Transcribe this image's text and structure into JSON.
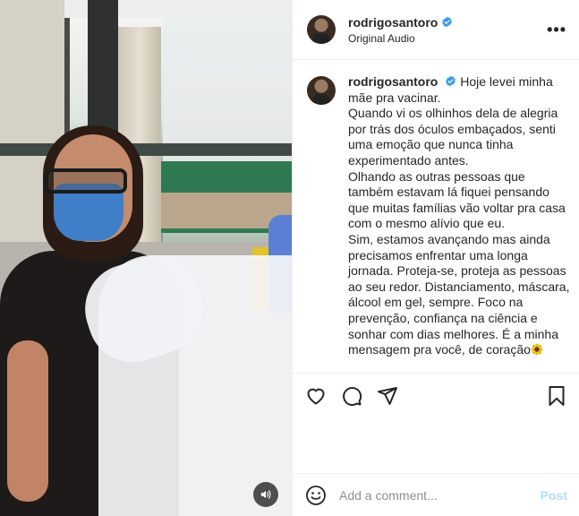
{
  "header": {
    "username": "rodrigosantoro",
    "audio_label": "Original Audio",
    "more_label": "•••"
  },
  "caption": {
    "username": "rodrigosantoro",
    "text": "Hoje levei minha mãe pra vacinar.\nQuando vi os olhinhos dela de alegria por trás dos óculos embaçados, senti uma emoção que nunca tinha experimentado antes.\nOlhando as outras pessoas que também estavam lá fiquei pensando que muitas famílias vão voltar pra casa com o mesmo alívio que eu.\nSim, estamos avançando mas ainda precisamos enfrentar uma longa jornada. Proteja-se, proteja as pessoas ao seu redor. Distanciamento, máscara, álcool em gel, sempre. Foco na prevenção, confiança na ciência e sonhar com dias melhores. É a minha mensagem pra você, de coração",
    "emoji": "sunflower-icon"
  },
  "comment": {
    "placeholder": "Add a comment...",
    "post_label": "Post"
  },
  "colors": {
    "verified": "#3897f0",
    "post_disabled": "#b3dbff",
    "text": "#262626",
    "muted": "#8e8e8e"
  }
}
